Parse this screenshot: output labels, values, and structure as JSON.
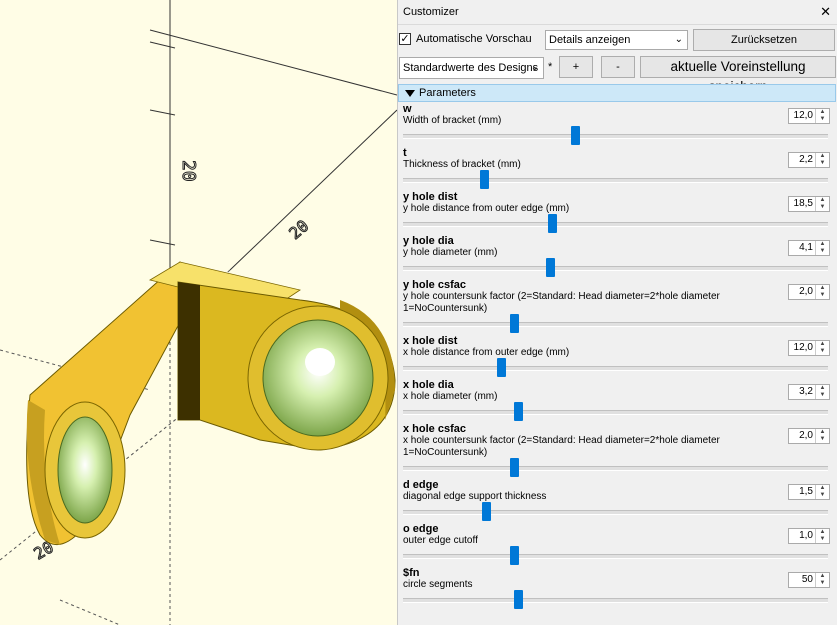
{
  "viewport": {
    "axis_labels": [
      "20",
      "20",
      "20"
    ]
  },
  "customizer": {
    "title": "Customizer",
    "close_label": "✕",
    "auto_preview_label": "Automatische Vorschau",
    "auto_preview_checked": true,
    "details_combo": "Details anzeigen",
    "reset_button": "Zurücksetzen",
    "preset_combo": "Standardwerte des Designs",
    "preset_modified": "*",
    "add_button": "+",
    "remove_button": "-",
    "save_button": "aktuelle Voreinstellung speichern",
    "group_title": "Parameters",
    "parameters": [
      {
        "name": "w",
        "desc": "Width of bracket (mm)",
        "value": "12,0",
        "slider_pos": 0.405
      },
      {
        "name": "t",
        "desc": "Thickness of bracket (mm)",
        "value": "2,2",
        "slider_pos": 0.19
      },
      {
        "name": "y hole dist",
        "desc": "y hole distance from outer edge (mm)",
        "value": "18,5",
        "slider_pos": 0.35
      },
      {
        "name": "y hole dia",
        "desc": "y hole diameter (mm)",
        "value": "4,1",
        "slider_pos": 0.345
      },
      {
        "name": "y hole csfac",
        "desc": "y hole countersunk factor (2=Standard: Head diameter=2*hole diameter 1=NoCountersunk)",
        "value": "2,0",
        "slider_pos": 0.26
      },
      {
        "name": "x hole dist",
        "desc": "x hole distance from outer edge (mm)",
        "value": "12,0",
        "slider_pos": 0.23
      },
      {
        "name": "x hole dia",
        "desc": "x hole diameter (mm)",
        "value": "3,2",
        "slider_pos": 0.27
      },
      {
        "name": "x hole csfac",
        "desc": "x hole countersunk factor (2=Standard: Head diameter=2*hole diameter 1=NoCountersunk)",
        "value": "2,0",
        "slider_pos": 0.26
      },
      {
        "name": "d edge",
        "desc": "diagonal edge support thickness",
        "value": "1,5",
        "slider_pos": 0.195
      },
      {
        "name": "o edge",
        "desc": "outer edge cutoff",
        "value": "1,0",
        "slider_pos": 0.26
      },
      {
        "name": "$fn",
        "desc": "circle segments",
        "value": "50",
        "slider_pos": 0.27
      }
    ]
  }
}
